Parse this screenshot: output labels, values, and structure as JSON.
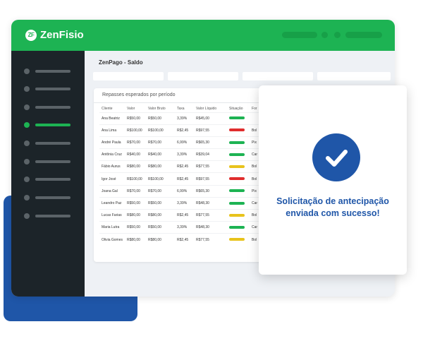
{
  "app": {
    "name": "ZenFisio",
    "logo_mark": "ZF"
  },
  "page": {
    "title": "ZenPago - Saldo"
  },
  "table": {
    "title": "Repasses esperados por período",
    "headers": [
      "Cliente",
      "Valor",
      "Valor Bruto",
      "Taxa",
      "Valor Líquido",
      "Situação",
      "For"
    ],
    "rows": [
      {
        "cliente": "Ana Beatriz",
        "valor": "R$50,00",
        "bruto": "R$50,00",
        "taxa": "3,39%",
        "liquido": "R$45,00",
        "status": "success",
        "forma": ""
      },
      {
        "cliente": "Ana Lima",
        "valor": "R$100,00",
        "bruto": "R$100,00",
        "taxa": "R$2,45",
        "liquido": "R$97,55",
        "status": "error",
        "forma": "Bol"
      },
      {
        "cliente": "André Paula",
        "valor": "R$70,00",
        "bruto": "R$70,00",
        "taxa": "6,99%",
        "liquido": "R$65,30",
        "status": "success",
        "forma": "Pix"
      },
      {
        "cliente": "Antônia Cruz",
        "valor": "R$40,00",
        "bruto": "R$40,00",
        "taxa": "3,39%",
        "liquido": "R$39,04",
        "status": "success",
        "forma": "Car"
      },
      {
        "cliente": "Fábio Aurus",
        "valor": "R$80,00",
        "bruto": "R$80,00",
        "taxa": "R$2,45",
        "liquido": "R$77,55",
        "status": "warning",
        "forma": "Bol"
      },
      {
        "cliente": "Igor José",
        "valor": "R$100,00",
        "bruto": "R$100,00",
        "taxa": "R$2,45",
        "liquido": "R$97,55",
        "status": "error",
        "forma": "Bol"
      },
      {
        "cliente": "Joana Gal",
        "valor": "R$70,00",
        "bruto": "R$70,00",
        "taxa": "6,99%",
        "liquido": "R$65,30",
        "status": "success",
        "forma": "Pix"
      },
      {
        "cliente": "Leandro Paz",
        "valor": "R$50,00",
        "bruto": "R$50,00",
        "taxa": "3,39%",
        "liquido": "R$48,30",
        "status": "success",
        "forma": "Car"
      },
      {
        "cliente": "Lucas Farias",
        "valor": "R$80,00",
        "bruto": "R$80,00",
        "taxa": "R$2,45",
        "liquido": "R$77,55",
        "status": "warning",
        "forma": "Bol"
      },
      {
        "cliente": "Maria Lutra",
        "valor": "R$50,00",
        "bruto": "R$50,00",
        "taxa": "3,39%",
        "liquido": "R$48,30",
        "status": "success",
        "forma": "Car"
      },
      {
        "cliente": "Olivia Gomes",
        "valor": "R$80,00",
        "bruto": "R$80,00",
        "taxa": "R$2,45",
        "liquido": "R$77,55",
        "status": "warning",
        "forma": "Bol"
      }
    ]
  },
  "modal": {
    "line1": "Solicitação de antecipação",
    "line2": "enviada com sucesso!",
    "icon": "check-circle-icon"
  },
  "colors": {
    "brand_green": "#1db353",
    "accent_blue": "#1f56a8",
    "sidebar_bg": "#1c2429",
    "status_success": "#1db353",
    "status_error": "#e02d2d",
    "status_warning": "#e8c31c"
  },
  "sidebar": {
    "items": 9,
    "active_index": 4
  }
}
